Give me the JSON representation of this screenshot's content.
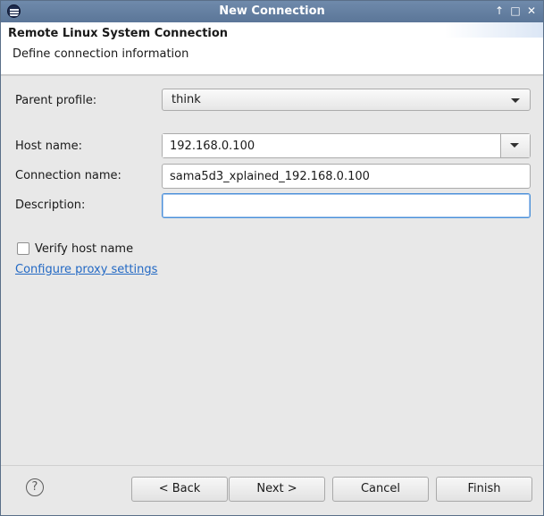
{
  "window": {
    "title": "New Connection",
    "controls": {
      "pin": "↑",
      "maximize": "□",
      "close": "✕"
    }
  },
  "banner": {
    "title": "Remote Linux System Connection",
    "description": "Define connection information"
  },
  "form": {
    "parent_profile": {
      "label": "Parent profile:",
      "value": "think"
    },
    "host_name": {
      "label": "Host name:",
      "value": "192.168.0.100"
    },
    "connection_name": {
      "label": "Connection name:",
      "value": "sama5d3_xplained_192.168.0.100"
    },
    "description": {
      "label": "Description:",
      "value": ""
    },
    "verify_host": {
      "label": "Verify host name",
      "checked": false
    },
    "proxy_link": "Configure proxy settings"
  },
  "footer": {
    "help_icon": "?",
    "back_label": "< Back",
    "next_label": "Next >",
    "cancel_label": "Cancel",
    "finish_label": "Finish"
  },
  "icons": [
    "eclipse-app-icon",
    "pin-icon",
    "maximize-icon",
    "close-icon",
    "chevron-down-icon",
    "help-icon"
  ],
  "colors": {
    "titlebar": "#5b7698",
    "link": "#2369c4",
    "focus": "#4a90d9"
  }
}
